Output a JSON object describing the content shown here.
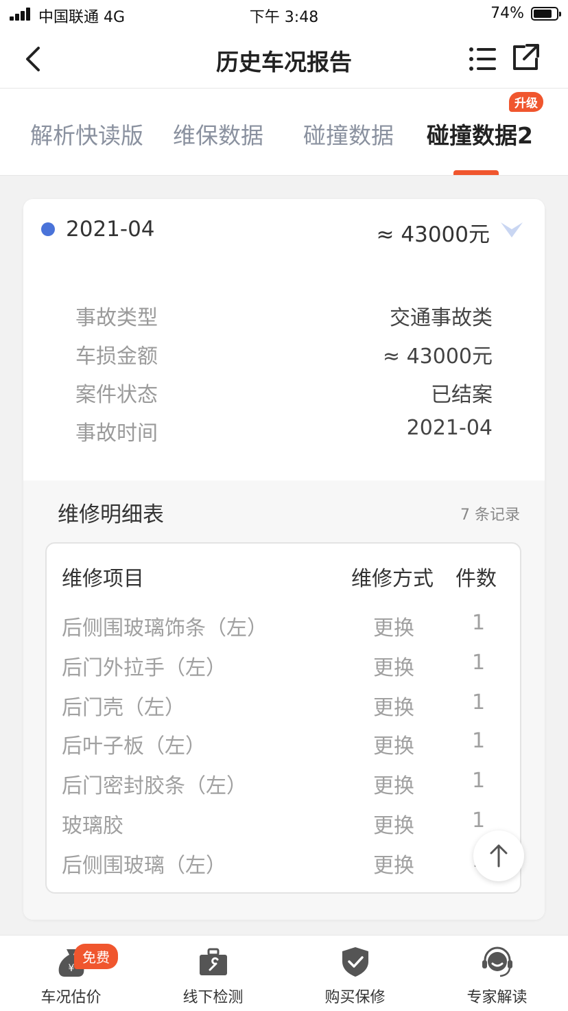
{
  "status_bar": {
    "carrier": "中国联通  4G",
    "time": "下午 3:48",
    "battery": "74%"
  },
  "nav": {
    "title": "历史车况报告"
  },
  "tabs": [
    {
      "label": "解析快读版"
    },
    {
      "label": "维保数据"
    },
    {
      "label": "碰撞数据"
    },
    {
      "label": "碰撞数据2",
      "badge": "升级"
    }
  ],
  "card": {
    "date": "2021-04",
    "amount": "≈ 43000元",
    "details": [
      {
        "label": "事故类型",
        "value": "交通事故类"
      },
      {
        "label": "车损金额",
        "value": "≈ 43000元"
      },
      {
        "label": "案件状态",
        "value": "已结案"
      },
      {
        "label": "事故时间",
        "value": "2021-04"
      }
    ],
    "repair": {
      "title": "维修明细表",
      "count": "7 条记录",
      "headers": {
        "item": "维修项目",
        "method": "维修方式",
        "qty": "件数"
      },
      "rows": [
        {
          "item": "后侧围玻璃饰条（左）",
          "method": "更换",
          "qty": "1"
        },
        {
          "item": "后门外拉手（左）",
          "method": "更换",
          "qty": "1"
        },
        {
          "item": "后门壳（左）",
          "method": "更换",
          "qty": "1"
        },
        {
          "item": "后叶子板（左）",
          "method": "更换",
          "qty": "1"
        },
        {
          "item": "后门密封胶条（左）",
          "method": "更换",
          "qty": "1"
        },
        {
          "item": "玻璃胶",
          "method": "更换",
          "qty": "1"
        },
        {
          "item": "后侧围玻璃（左）",
          "method": "更换",
          "qty": "1"
        }
      ]
    }
  },
  "bottom_bar": [
    {
      "label": "车况估价",
      "badge": "免费",
      "icon": "money-bag-icon"
    },
    {
      "label": "线下检测",
      "icon": "toolbox-icon"
    },
    {
      "label": "购买保修",
      "icon": "shield-check-icon"
    },
    {
      "label": "专家解读",
      "icon": "headset-icon"
    }
  ],
  "colors": {
    "accent": "#f0562e",
    "dot": "#4a73d9"
  }
}
